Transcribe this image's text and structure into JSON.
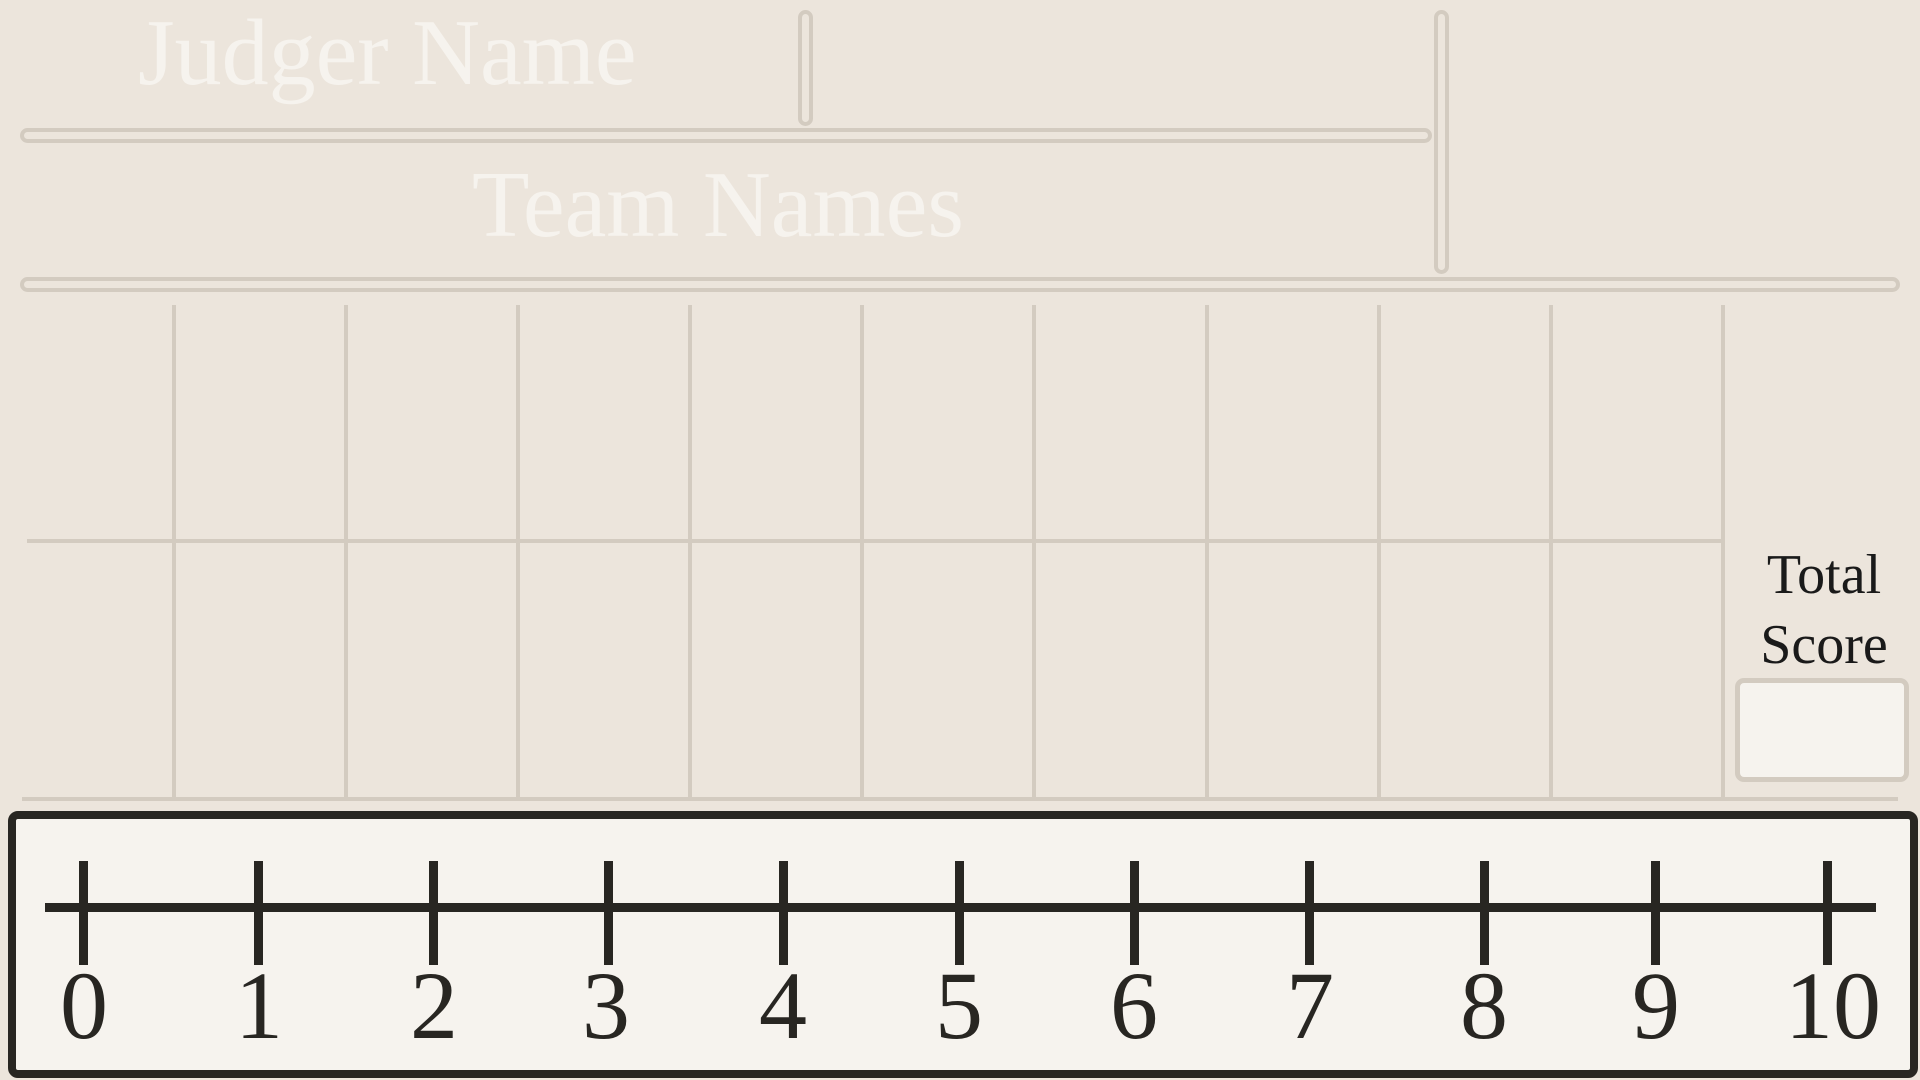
{
  "header": {
    "judger_label": "Judger Name",
    "team_label": "Team Names"
  },
  "total": {
    "label_line1": "Total",
    "label_line2": "Score"
  },
  "scale": {
    "ticks": [
      "0",
      "1",
      "2",
      "3",
      "4",
      "5",
      "6",
      "7",
      "8",
      "9",
      "10"
    ]
  }
}
